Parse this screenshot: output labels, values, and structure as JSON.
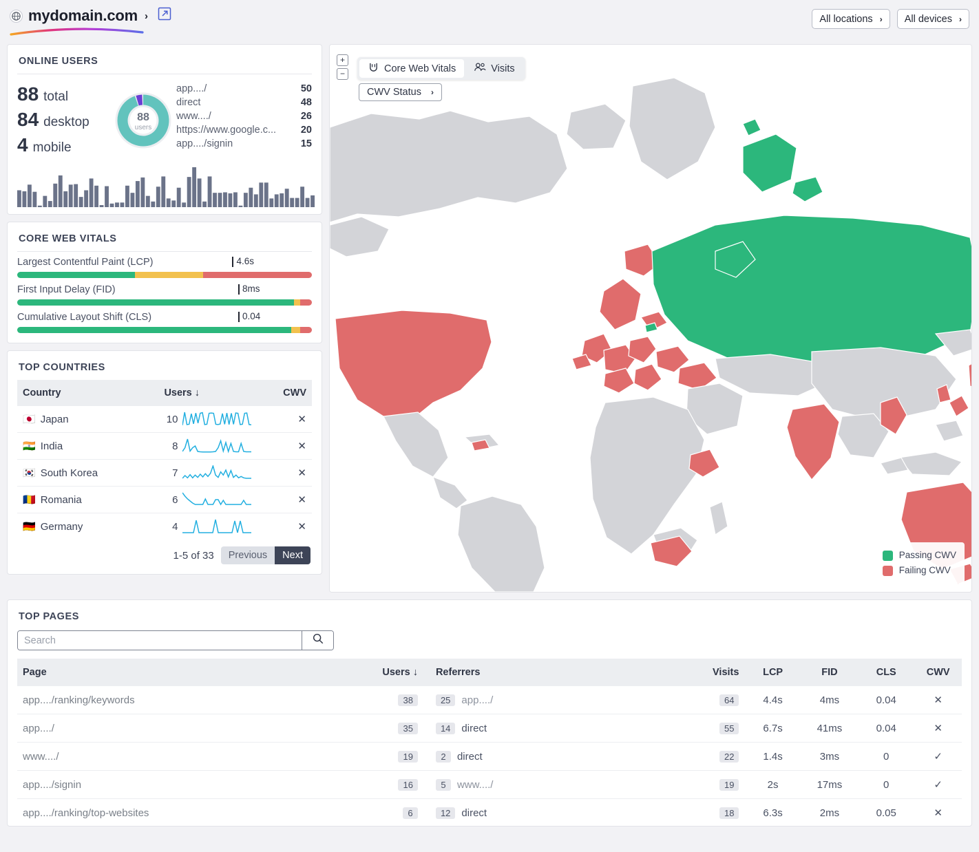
{
  "header": {
    "globe_icon": "globe-icon",
    "domain": "mydomain.com",
    "chevron": "›",
    "external_link_icon": "external-link-icon",
    "filters": [
      {
        "label": "All locations",
        "chevron": "›"
      },
      {
        "label": "All devices",
        "chevron": "›"
      }
    ]
  },
  "online_users": {
    "title": "ONLINE USERS",
    "stats": [
      {
        "value": "88",
        "label": "total"
      },
      {
        "value": "84",
        "label": "desktop"
      },
      {
        "value": "4",
        "label": "mobile"
      }
    ],
    "donut": {
      "center_value": "88",
      "center_label": "users",
      "segments": [
        {
          "name": "desktop",
          "value": 84,
          "color": "#62c3bd"
        },
        {
          "name": "mobile",
          "value": 4,
          "color": "#6b3fd4"
        }
      ]
    },
    "referrers": [
      {
        "label": "app..../",
        "value": "50"
      },
      {
        "label": "direct",
        "value": "48"
      },
      {
        "label": "www..../",
        "value": "26"
      },
      {
        "label": "https://www.google.c...",
        "value": "20"
      },
      {
        "label": "app..../signin",
        "value": "15"
      }
    ],
    "activity_bars": [
      33,
      31,
      44,
      30,
      3,
      22,
      12,
      46,
      62,
      31,
      44,
      45,
      20,
      33,
      56,
      42,
      4,
      41,
      7,
      9,
      9,
      42,
      28,
      51,
      58,
      22,
      11,
      40,
      60,
      17,
      13,
      38,
      9,
      59,
      78,
      56,
      11,
      60,
      28,
      28,
      29,
      27,
      29,
      3,
      28,
      38,
      25,
      48,
      48,
      17,
      25,
      27,
      36,
      18,
      18,
      40,
      18,
      23
    ]
  },
  "core_web_vitals": {
    "title": "CORE WEB VITALS",
    "metrics": [
      {
        "name": "Largest Contentful Paint (LCP)",
        "value": "4.6s",
        "marker_pct": 73,
        "segments": [
          {
            "color": "#2cb77c",
            "pct": 40
          },
          {
            "color": "#f2c14e",
            "pct": 23
          },
          {
            "color": "#e06c6c",
            "pct": 37
          }
        ]
      },
      {
        "name": "First Input Delay (FID)",
        "value": "8ms",
        "marker_pct": 75,
        "segments": [
          {
            "color": "#2cb77c",
            "pct": 94
          },
          {
            "color": "#f2c14e",
            "pct": 2
          },
          {
            "color": "#e06c6c",
            "pct": 4
          }
        ]
      },
      {
        "name": "Cumulative Layout Shift (CLS)",
        "value": "0.04",
        "marker_pct": 75,
        "segments": [
          {
            "color": "#2cb77c",
            "pct": 93
          },
          {
            "color": "#f2c14e",
            "pct": 3
          },
          {
            "color": "#e06c6c",
            "pct": 4
          }
        ]
      }
    ]
  },
  "top_countries": {
    "title": "TOP COUNTRIES",
    "columns": [
      "Country",
      "Users ↓",
      "CWV"
    ],
    "rows": [
      {
        "flag": "🇯🇵",
        "country": "Japan",
        "users": "10",
        "cwv": "✕",
        "spark": [
          5,
          95,
          10,
          12,
          85,
          15,
          90,
          20,
          88,
          92,
          10,
          12,
          88,
          90,
          88,
          12,
          10,
          14,
          86,
          12,
          90,
          10,
          88,
          12,
          90,
          88,
          10,
          12,
          88,
          90,
          10,
          8
        ]
      },
      {
        "flag": "🇮🇳",
        "country": "India",
        "users": "8",
        "cwv": "✕",
        "spark": [
          8,
          30,
          80,
          10,
          30,
          40,
          8,
          6,
          5,
          5,
          5,
          5,
          6,
          8,
          30,
          70,
          10,
          60,
          8,
          55,
          8,
          6,
          6,
          55,
          8,
          6,
          6,
          6
        ]
      },
      {
        "flag": "🇰🇷",
        "country": "South Korea",
        "users": "7",
        "cwv": "✕",
        "spark": [
          6,
          18,
          8,
          22,
          8,
          20,
          10,
          24,
          12,
          26,
          14,
          28,
          60,
          20,
          10,
          34,
          20,
          42,
          12,
          40,
          10,
          20,
          8,
          14,
          8,
          6,
          6,
          6
        ]
      },
      {
        "flag": "🇷🇴",
        "country": "Romania",
        "users": "6",
        "cwv": "✕",
        "spark": [
          40,
          30,
          22,
          16,
          10,
          6,
          6,
          6,
          6,
          22,
          6,
          6,
          6,
          20,
          20,
          6,
          18,
          6,
          6,
          6,
          6,
          6,
          6,
          6,
          18,
          6,
          6,
          6
        ]
      },
      {
        "flag": "🇩🇪",
        "country": "Germany",
        "users": "4",
        "cwv": "✕",
        "spark": [
          4,
          4,
          4,
          4,
          4,
          80,
          4,
          4,
          4,
          4,
          4,
          4,
          84,
          4,
          4,
          4,
          4,
          4,
          4,
          76,
          4,
          76,
          4,
          4,
          4,
          4
        ]
      }
    ],
    "pagination": {
      "count": "1-5 of 33",
      "previous": "Previous",
      "next": "Next"
    }
  },
  "map": {
    "zoom_in": "+",
    "zoom_out": "−",
    "tabs": [
      {
        "label": "Core Web Vitals",
        "icon": "cwv-icon",
        "active": true
      },
      {
        "label": "Visits",
        "icon": "users-icon",
        "active": false
      }
    ],
    "status_filter": {
      "label": "CWV Status",
      "chevron": "›"
    },
    "legend": [
      {
        "label": "Passing CWV",
        "color": "#2cb77c"
      },
      {
        "label": "Failing CWV",
        "color": "#e06c6c"
      }
    ],
    "colors": {
      "passing": "#2cb77c",
      "failing": "#e06c6c",
      "neutral": "#d3d4d8",
      "ocean": "#ffffff"
    }
  },
  "top_pages": {
    "title": "TOP PAGES",
    "search": {
      "placeholder": "Search",
      "value": "",
      "icon": "search-icon"
    },
    "columns": [
      "Page",
      "Users ↓",
      "Referrers",
      "Visits",
      "LCP",
      "FID",
      "CLS",
      "CWV"
    ],
    "rows": [
      {
        "page": "app..../ranking/keywords",
        "users": "38",
        "ref_count": "25",
        "referrer": "app..../",
        "referrer_muted": true,
        "visits": "64",
        "lcp": "4.4s",
        "fid": "4ms",
        "cls": "0.04",
        "cwv": "✕",
        "cwv_pass": false
      },
      {
        "page": "app..../",
        "users": "35",
        "ref_count": "14",
        "referrer": "direct",
        "referrer_muted": false,
        "visits": "55",
        "lcp": "6.7s",
        "fid": "41ms",
        "cls": "0.04",
        "cwv": "✕",
        "cwv_pass": false
      },
      {
        "page": "www..../",
        "users": "19",
        "ref_count": "2",
        "referrer": "direct",
        "referrer_muted": false,
        "visits": "22",
        "lcp": "1.4s",
        "fid": "3ms",
        "cls": "0",
        "cwv": "✓",
        "cwv_pass": true
      },
      {
        "page": "app..../signin",
        "users": "16",
        "ref_count": "5",
        "referrer": "www..../",
        "referrer_muted": true,
        "visits": "19",
        "lcp": "2s",
        "fid": "17ms",
        "cls": "0",
        "cwv": "✓",
        "cwv_pass": true
      },
      {
        "page": "app..../ranking/top-websites",
        "users": "6",
        "ref_count": "12",
        "referrer": "direct",
        "referrer_muted": false,
        "visits": "18",
        "lcp": "6.3s",
        "fid": "2ms",
        "cls": "0.05",
        "cwv": "✕",
        "cwv_pass": false
      }
    ]
  }
}
